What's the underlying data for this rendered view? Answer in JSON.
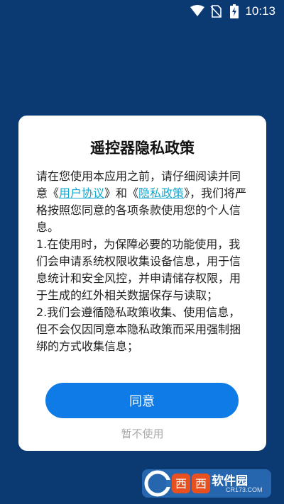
{
  "status_bar": {
    "time": "10:13",
    "icons": [
      "wifi-icon",
      "no-sim-icon",
      "battery-charging-icon"
    ]
  },
  "dialog": {
    "title": "遥控器隐私政策",
    "intro_before_link1": "请在您使用本应用之前，请仔细阅读并同意《",
    "link_user_agreement": "用户协议",
    "intro_between": "》和《",
    "link_privacy_policy": "隐私政策",
    "intro_after": "》，我们将严格按照您同意的各项条款使用您的个人信息。",
    "item1": "1.在使用时，为保障必要的功能使用，我们会申请系统权限收集设备信息，用于信息统计和安全风控，并申请储存权限，用于生成的红外相关数据保存与读取；",
    "item2": "2.我们会遵循隐私政策收集、使用信息，但不会仅因同意本隐私政策而采用强制捆绑的方式收集信息；",
    "agree_label": "同意",
    "decline_label": "暂不使用"
  },
  "watermark": {
    "brand": "软件园",
    "site": "CR173.COM"
  },
  "colors": {
    "background": "#0b3a73",
    "accent": "#0f7be6",
    "link": "#13a8cf"
  }
}
